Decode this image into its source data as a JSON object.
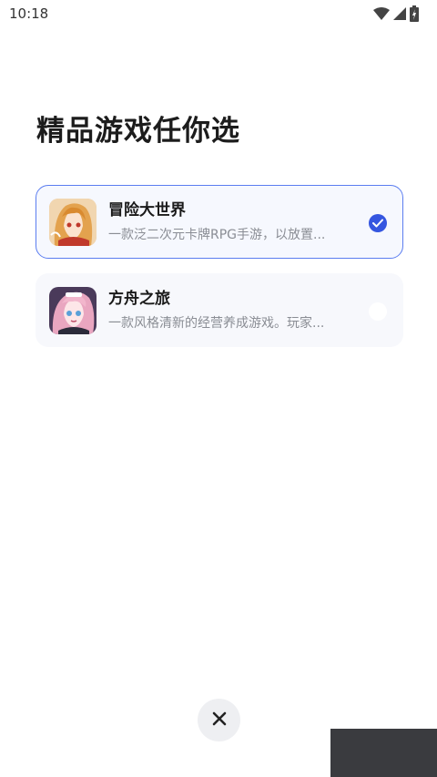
{
  "status_bar": {
    "time": "10:18",
    "icons": [
      "wifi-icon",
      "signal-icon",
      "battery-charging-icon"
    ]
  },
  "title": "精品游戏任你选",
  "games": [
    {
      "name": "冒险大世界",
      "description": "一款泛二次元卡牌RPG手游，以放置...",
      "selected": true,
      "thumb_icon": "anime-girl-blonde-thumbnail"
    },
    {
      "name": "方舟之旅",
      "description": "一款风格清新的经营养成游戏。玩家...",
      "selected": false,
      "thumb_icon": "anime-girl-pink-thumbnail"
    }
  ],
  "close_icon": "close-icon",
  "colors": {
    "accent": "#3556e0",
    "selected_border": "#5b7df0",
    "card_bg": "#f7f8fc",
    "desc_text": "#8a8d94"
  }
}
